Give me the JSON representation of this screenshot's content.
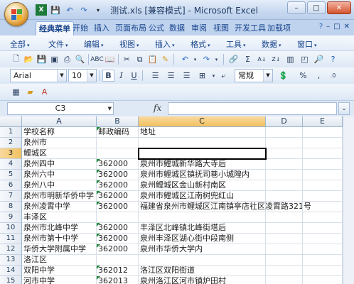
{
  "window": {
    "title": "测试.xls  [兼容模式] - Microsoft Excel",
    "buttons": {
      "minimize": "–",
      "maximize": "□",
      "close": "✕"
    }
  },
  "ribbon_tabs": [
    "经典菜单",
    "开始",
    "插入",
    "页面布局",
    "公式",
    "数据",
    "审阅",
    "视图",
    "开发工具",
    "加载项"
  ],
  "menu_row": [
    "全部",
    "文件",
    "编辑",
    "视图",
    "插入",
    "格式",
    "工具",
    "数据",
    "窗口"
  ],
  "toolbar": {
    "font_name": "Arial",
    "font_size": "10",
    "number_format": "常规",
    "bold": "B",
    "italic": "I",
    "underline": "U",
    "percent": "%",
    "comma": ",",
    "sum": "Σ"
  },
  "formula_bar": {
    "name_box": "C3",
    "fx_label": "fx",
    "content": ""
  },
  "sheet": {
    "columns": [
      "A",
      "B",
      "C",
      "D",
      "E"
    ],
    "selected_column": "C",
    "selected_row": "3",
    "rows": [
      {
        "num": "1",
        "a": "学校名称",
        "b": "邮政编码",
        "c": "地址"
      },
      {
        "num": "2",
        "a": "泉州市",
        "b": "",
        "c": ""
      },
      {
        "num": "3",
        "a": "鲤城区",
        "b": "",
        "c": ""
      },
      {
        "num": "4",
        "a": "泉州四中",
        "b": "362000",
        "c": "泉州市鲤城新华路大寺后"
      },
      {
        "num": "5",
        "a": "泉州六中",
        "b": "362000",
        "c": "泉州市鲤城区镇抚司巷小城隍内"
      },
      {
        "num": "6",
        "a": "泉州八中",
        "b": "362000",
        "c": "泉州鲤城区金山新村南区"
      },
      {
        "num": "7",
        "a": "泉州市明新华侨中学",
        "b": "362000",
        "c": "泉州市鲤城区江南树兜红山"
      },
      {
        "num": "8",
        "a": "泉州凌霄中学",
        "b": "362000",
        "c": "福建省泉州市鲤城区江南镇亭店社区凌霄路321号"
      },
      {
        "num": "9",
        "a": "丰泽区",
        "b": "",
        "c": ""
      },
      {
        "num": "10",
        "a": "泉州市北峰中学",
        "b": "362000",
        "c": "丰泽区北峰镇北峰街塔后"
      },
      {
        "num": "11",
        "a": "泉州市第十中学",
        "b": "362000",
        "c": "泉州丰泽区湖心街中段南侧"
      },
      {
        "num": "12",
        "a": "华侨大学附属中学",
        "b": "362000",
        "c": "泉州市华侨大学内"
      },
      {
        "num": "13",
        "a": "洛江区",
        "b": "",
        "c": ""
      },
      {
        "num": "14",
        "a": "双阳中学",
        "b": "362012",
        "c": "洛江区双阳街道"
      },
      {
        "num": "15",
        "a": "河市中学",
        "b": "362013",
        "c": "泉州洛江区河市镇炉田村"
      }
    ]
  }
}
